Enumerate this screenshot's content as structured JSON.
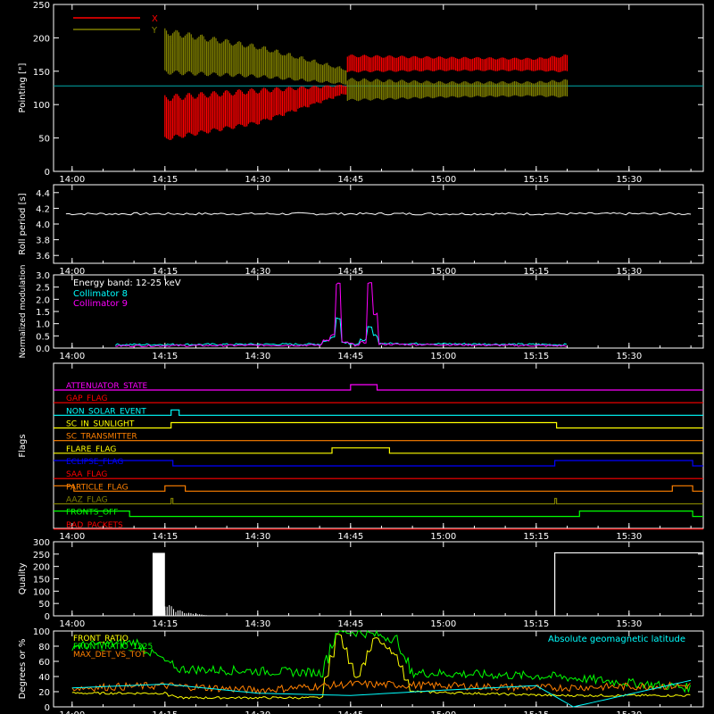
{
  "colors": {
    "background": "#000000",
    "axis": "#ffffff",
    "x_pointing": "#ff0000",
    "y_pointing": "#808000",
    "roll": "#ffffff",
    "collimator8": "#00ffff",
    "collimator9": "#ff00ff",
    "quality": "#ffffff",
    "front_ratio": "#ffff00",
    "front_ratio_1225": "#00ff00",
    "max_det_vs_tot": "#ff8000",
    "geomag_lat": "#00ffff"
  },
  "time_axis": {
    "ticks": [
      "14:00",
      "14:15",
      "14:30",
      "14:45",
      "15:00",
      "15:15",
      "15:30"
    ]
  },
  "chart_data": [
    {
      "id": "pointing",
      "type": "area",
      "ylabel": "Pointing [\"]",
      "ylim": [
        0,
        250
      ],
      "yticks": [
        "0",
        "50",
        "100",
        "150",
        "200",
        "250"
      ],
      "legend": [
        "X",
        "Y"
      ],
      "legend_position": "top-left",
      "series": [
        {
          "name": "X",
          "x": [
            "14:15",
            "14:30",
            "14:44",
            "14:45",
            "15:00",
            "15:15",
            "15:20"
          ],
          "min": [
            45,
            70,
            115,
            148,
            150,
            150,
            148
          ],
          "max": [
            115,
            125,
            130,
            175,
            172,
            170,
            175
          ],
          "color": "#ff0000"
        },
        {
          "name": "Y",
          "x": [
            "14:15",
            "14:30",
            "14:44",
            "14:45",
            "15:00",
            "15:15",
            "15:20"
          ],
          "min": [
            145,
            140,
            130,
            105,
            110,
            112,
            110
          ],
          "max": [
            215,
            190,
            155,
            140,
            135,
            135,
            138
          ],
          "color": "#808000"
        }
      ],
      "reference_line": 128
    },
    {
      "id": "roll_period",
      "type": "line",
      "ylabel": "Roll period [s]",
      "ylim": [
        3.5,
        4.5
      ],
      "yticks": [
        "3.6",
        "3.8",
        "4.0",
        "4.2",
        "4.4"
      ],
      "series": [
        {
          "name": "",
          "x": [
            "13:59",
            "15:40"
          ],
          "y": [
            4.13,
            4.13
          ]
        }
      ]
    },
    {
      "id": "modulation",
      "type": "line",
      "ylabel": "Normalized modulation",
      "ylim": [
        0,
        3.0
      ],
      "yticks": [
        "0.0",
        "0.5",
        "1.0",
        "1.5",
        "2.0",
        "2.5",
        "3.0"
      ],
      "annotation": "Energy band: 12-25 keV",
      "legend": [
        "Collimator 8",
        "Collimator 9"
      ],
      "legend_position": "top-left",
      "series": [
        {
          "name": "Collimator 8",
          "x": [
            "14:07",
            "14:40",
            "14:42",
            "14:43",
            "14:44",
            "14:46",
            "14:47",
            "14:48",
            "14:50",
            "15:20"
          ],
          "y": [
            0.1,
            0.12,
            0.4,
            1.2,
            0.2,
            0.1,
            0.3,
            0.8,
            0.15,
            0.1
          ]
        },
        {
          "name": "Collimator 9",
          "x": [
            "14:07",
            "14:40",
            "14:42",
            "14:43",
            "14:44",
            "14:46",
            "14:47",
            "14:48",
            "14:50",
            "15:20"
          ],
          "y": [
            0.05,
            0.08,
            0.5,
            2.6,
            0.2,
            0.05,
            0.2,
            2.6,
            0.12,
            0.05
          ]
        }
      ]
    },
    {
      "id": "flags",
      "type": "line",
      "ylabel": "Flags",
      "flags": [
        {
          "name": "ATTENUATOR_STATE",
          "color": "#ff00ff",
          "high": [
            [
              "14:45",
              "14:49"
            ]
          ]
        },
        {
          "name": "GAP_FLAG",
          "color": "#ff0000",
          "high": []
        },
        {
          "name": "NON_SOLAR_EVENT",
          "color": "#00ffff",
          "high": [
            [
              "14:16",
              "14:17"
            ]
          ]
        },
        {
          "name": "SC_IN_SUNLIGHT",
          "color": "#ffff00",
          "high": [
            [
              "14:16",
              "15:18"
            ]
          ]
        },
        {
          "name": "SC_TRANSMITTER",
          "color": "#ff8000",
          "high": []
        },
        {
          "name": "FLARE_FLAG",
          "color": "#ffff00",
          "high": [
            [
              "14:42",
              "14:51"
            ]
          ]
        },
        {
          "name": "ECLIPSE_FLAG",
          "color": "#0000ff",
          "high": [
            [
              "13:59",
              "14:16"
            ],
            [
              "15:18",
              "15:40"
            ]
          ]
        },
        {
          "name": "SAA_FLAG",
          "color": "#ff0000",
          "high": []
        },
        {
          "name": "PARTICLE_FLAG",
          "color": "#ff8000",
          "high": [
            [
              "13:59",
              "14:00"
            ],
            [
              "14:15",
              "14:18"
            ],
            [
              "15:37",
              "15:40"
            ]
          ]
        },
        {
          "name": "AAZ_FLAG",
          "color": "#808000",
          "high": [
            [
              "14:16",
              "14:16"
            ],
            [
              "15:18",
              "15:18"
            ]
          ]
        },
        {
          "name": "FRONTS_OFF",
          "color": "#00ff00",
          "high": [
            [
              "13:59",
              "14:09"
            ],
            [
              "15:22",
              "15:40"
            ]
          ]
        },
        {
          "name": "BAD_PACKETS",
          "color": "#ff0000",
          "high": []
        }
      ]
    },
    {
      "id": "quality",
      "type": "bar",
      "ylabel": "Quality",
      "ylim": [
        0,
        300
      ],
      "yticks": [
        "0",
        "50",
        "100",
        "150",
        "200",
        "250",
        "300"
      ],
      "series": [
        {
          "name": "",
          "x": [
            "14:13",
            "14:15",
            "14:16",
            "14:17",
            "14:18",
            "14:19",
            "14:20",
            "15:18",
            "15:40"
          ],
          "y": [
            255,
            255,
            40,
            30,
            20,
            15,
            5,
            255,
            255
          ]
        }
      ]
    },
    {
      "id": "ratios",
      "type": "line",
      "ylabel": "Degrees or %",
      "ylim": [
        0,
        100
      ],
      "yticks": [
        "0",
        "20",
        "40",
        "60",
        "80",
        "100"
      ],
      "legend": [
        "FRONT_RATIO",
        "FRONT_RATIO_1225",
        "MAX_DET_VS_TOT"
      ],
      "legend_position": "top-left",
      "annotation": "Absolute geomagnetic latitude",
      "series": [
        {
          "name": "FRONT_RATIO",
          "x": [
            "14:00",
            "14:15",
            "14:17",
            "14:40",
            "14:43",
            "14:46",
            "14:49",
            "14:52",
            "14:55",
            "15:18",
            "15:40"
          ],
          "y": [
            18,
            18,
            12,
            12,
            95,
            40,
            90,
            70,
            20,
            15,
            15
          ]
        },
        {
          "name": "FRONT_RATIO_1225",
          "x": [
            "14:00",
            "14:10",
            "14:17",
            "14:40",
            "14:43",
            "14:46",
            "14:49",
            "14:52",
            "14:55",
            "15:18",
            "15:40"
          ],
          "y": [
            80,
            85,
            50,
            45,
            100,
            98,
            95,
            90,
            45,
            40,
            25
          ]
        },
        {
          "name": "MAX_DET_VS_TOT",
          "x": [
            "14:00",
            "14:15",
            "14:30",
            "14:45",
            "15:00",
            "15:15",
            "15:40"
          ],
          "y": [
            25,
            28,
            22,
            30,
            28,
            25,
            28
          ]
        },
        {
          "name": "Absolute geomagnetic latitude",
          "x": [
            "14:00",
            "14:15",
            "14:30",
            "14:45",
            "15:00",
            "15:15",
            "15:21",
            "15:40"
          ],
          "y": [
            25,
            30,
            18,
            15,
            22,
            28,
            0,
            35
          ]
        }
      ]
    }
  ]
}
